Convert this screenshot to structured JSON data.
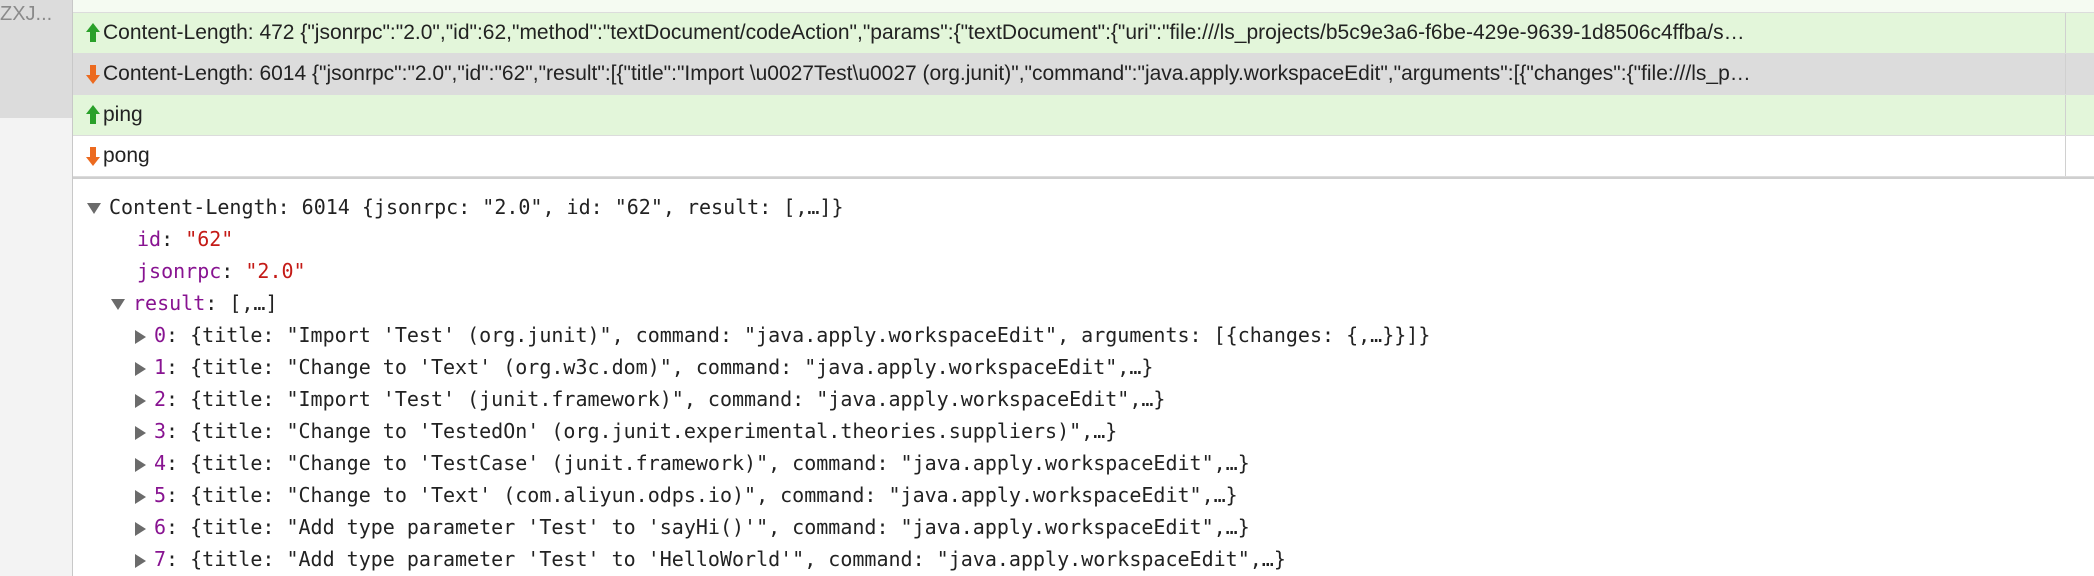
{
  "left_panel": {
    "truncated_name": "ZXJ..."
  },
  "frames": [
    {
      "direction": "sent",
      "text": "Content-Length: 472  {\"jsonrpc\":\"2.0\",\"id\":62,\"method\":\"textDocument/codeAction\",\"params\":{\"textDocument\":{\"uri\":\"file:///ls_projects/b5c9e3a6-f6be-429e-9639-1d8506c4ffba/s…"
    },
    {
      "direction": "received",
      "text": "Content-Length: 6014  {\"jsonrpc\":\"2.0\",\"id\":\"62\",\"result\":[{\"title\":\"Import \\u0027Test\\u0027 (org.junit)\",\"command\":\"java.apply.workspaceEdit\",\"arguments\":[{\"changes\":{\"file:///ls_p…"
    },
    {
      "direction": "sent",
      "text": "ping"
    },
    {
      "direction": "received",
      "text": "pong"
    }
  ],
  "detail": {
    "root_label": "Content-Length: 6014  {jsonrpc: \"2.0\", id: \"62\", result: [,…]}",
    "id": {
      "key": "id",
      "value": "\"62\""
    },
    "jsonrpc": {
      "key": "jsonrpc",
      "value": "\"2.0\""
    },
    "result": {
      "key": "result",
      "summary": " [,…]"
    },
    "items": [
      {
        "index": "0",
        "text": " {title: \"Import 'Test' (org.junit)\", command: \"java.apply.workspaceEdit\", arguments: [{changes: {,…}}]}"
      },
      {
        "index": "1",
        "text": " {title: \"Change to 'Text' (org.w3c.dom)\", command: \"java.apply.workspaceEdit\",…}"
      },
      {
        "index": "2",
        "text": " {title: \"Import 'Test' (junit.framework)\", command: \"java.apply.workspaceEdit\",…}"
      },
      {
        "index": "3",
        "text": " {title: \"Change to 'TestedOn' (org.junit.experimental.theories.suppliers)\",…}"
      },
      {
        "index": "4",
        "text": " {title: \"Change to 'TestCase' (junit.framework)\", command: \"java.apply.workspaceEdit\",…}"
      },
      {
        "index": "5",
        "text": " {title: \"Change to 'Text' (com.aliyun.odps.io)\", command: \"java.apply.workspaceEdit\",…}"
      },
      {
        "index": "6",
        "text": " {title: \"Add type parameter 'Test' to 'sayHi()'\", command: \"java.apply.workspaceEdit\",…}"
      },
      {
        "index": "7",
        "text": " {title: \"Add type parameter 'Test' to 'HelloWorld'\", command: \"java.apply.workspaceEdit\",…}"
      }
    ]
  }
}
